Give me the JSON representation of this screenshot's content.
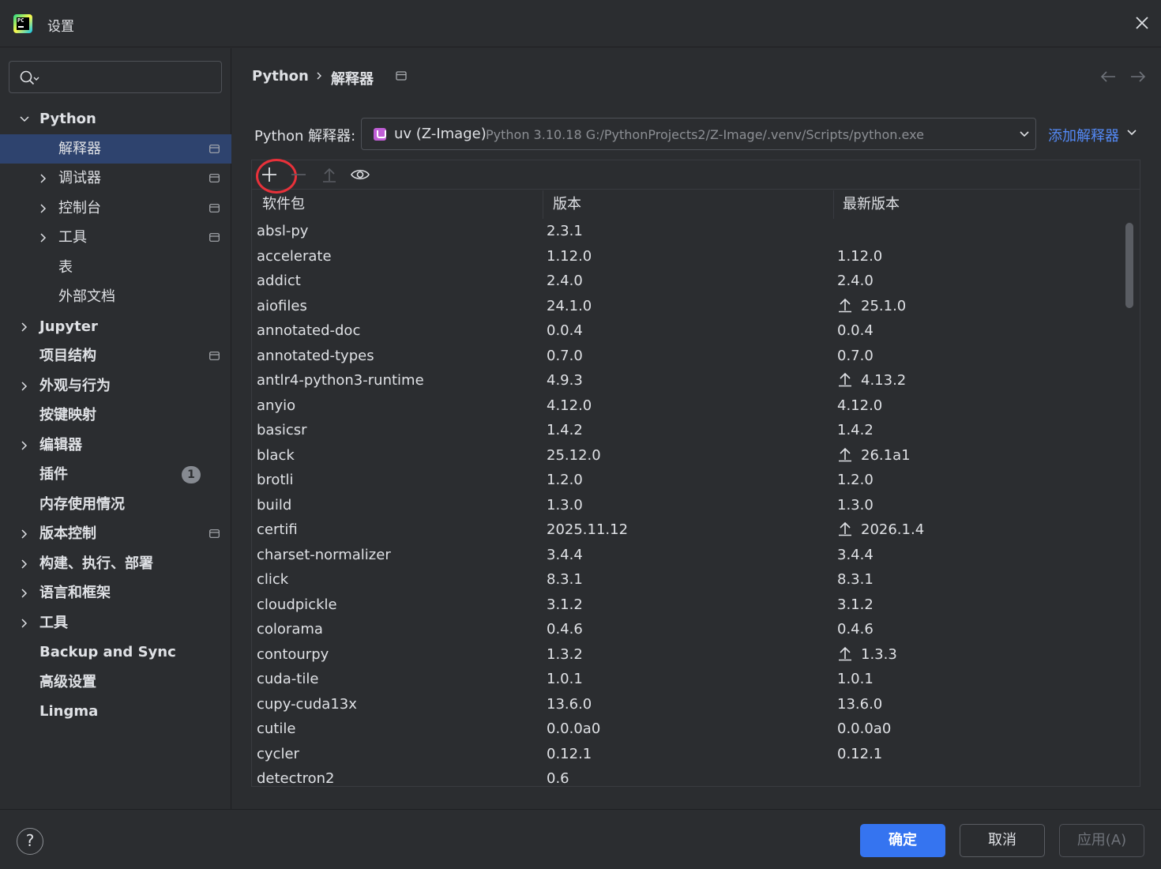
{
  "window": {
    "title": "设置"
  },
  "sidebar": {
    "items": [
      {
        "label": "Python",
        "level": 0,
        "expanded": true,
        "bold": true,
        "has_page_icon": false
      },
      {
        "label": "解释器",
        "level": 1,
        "selected": true,
        "has_page_icon": true
      },
      {
        "label": "调试器",
        "level": 1,
        "collapsed": true,
        "has_page_icon": true
      },
      {
        "label": "控制台",
        "level": 1,
        "collapsed": true,
        "has_page_icon": true
      },
      {
        "label": "工具",
        "level": 1,
        "collapsed": true,
        "has_page_icon": true
      },
      {
        "label": "表",
        "level": 1
      },
      {
        "label": "外部文档",
        "level": 1
      },
      {
        "label": "Jupyter",
        "level": 0,
        "collapsed": true,
        "bold": true
      },
      {
        "label": "项目结构",
        "level": 0,
        "bold": true,
        "has_page_icon": true
      },
      {
        "label": "外观与行为",
        "level": 0,
        "collapsed": true,
        "bold": true
      },
      {
        "label": "按键映射",
        "level": 0,
        "bold": true
      },
      {
        "label": "编辑器",
        "level": 0,
        "collapsed": true,
        "bold": true
      },
      {
        "label": "插件",
        "level": 0,
        "bold": true,
        "badge": "1"
      },
      {
        "label": "内存使用情况",
        "level": 0,
        "bold": true
      },
      {
        "label": "版本控制",
        "level": 0,
        "collapsed": true,
        "bold": true,
        "has_page_icon": true
      },
      {
        "label": "构建、执行、部署",
        "level": 0,
        "collapsed": true,
        "bold": true
      },
      {
        "label": "语言和框架",
        "level": 0,
        "collapsed": true,
        "bold": true
      },
      {
        "label": "工具",
        "level": 0,
        "collapsed": true,
        "bold": true
      },
      {
        "label": "Backup and Sync",
        "level": 0,
        "bold": true
      },
      {
        "label": "高级设置",
        "level": 0,
        "bold": true
      },
      {
        "label": "Lingma",
        "level": 0,
        "bold": true
      }
    ]
  },
  "breadcrumb": {
    "root": "Python",
    "current": "解释器"
  },
  "interpreter": {
    "label": "Python 解释器:",
    "name": "uv (Z-Image)",
    "detail": "Python 3.10.18 G:/PythonProjects2/Z-Image/.venv/Scripts/python.exe",
    "add_label": "添加解释器"
  },
  "packages": {
    "columns": [
      "软件包",
      "版本",
      "最新版本"
    ],
    "rows": [
      {
        "name": "absl-py",
        "version": "2.3.1",
        "latest": "",
        "upgrade": false
      },
      {
        "name": "accelerate",
        "version": "1.12.0",
        "latest": "1.12.0",
        "upgrade": false
      },
      {
        "name": "addict",
        "version": "2.4.0",
        "latest": "2.4.0",
        "upgrade": false
      },
      {
        "name": "aiofiles",
        "version": "24.1.0",
        "latest": "25.1.0",
        "upgrade": true
      },
      {
        "name": "annotated-doc",
        "version": "0.0.4",
        "latest": "0.0.4",
        "upgrade": false
      },
      {
        "name": "annotated-types",
        "version": "0.7.0",
        "latest": "0.7.0",
        "upgrade": false
      },
      {
        "name": "antlr4-python3-runtime",
        "version": "4.9.3",
        "latest": "4.13.2",
        "upgrade": true
      },
      {
        "name": "anyio",
        "version": "4.12.0",
        "latest": "4.12.0",
        "upgrade": false
      },
      {
        "name": "basicsr",
        "version": "1.4.2",
        "latest": "1.4.2",
        "upgrade": false
      },
      {
        "name": "black",
        "version": "25.12.0",
        "latest": "26.1a1",
        "upgrade": true
      },
      {
        "name": "brotli",
        "version": "1.2.0",
        "latest": "1.2.0",
        "upgrade": false
      },
      {
        "name": "build",
        "version": "1.3.0",
        "latest": "1.3.0",
        "upgrade": false
      },
      {
        "name": "certifi",
        "version": "2025.11.12",
        "latest": "2026.1.4",
        "upgrade": true
      },
      {
        "name": "charset-normalizer",
        "version": "3.4.4",
        "latest": "3.4.4",
        "upgrade": false
      },
      {
        "name": "click",
        "version": "8.3.1",
        "latest": "8.3.1",
        "upgrade": false
      },
      {
        "name": "cloudpickle",
        "version": "3.1.2",
        "latest": "3.1.2",
        "upgrade": false
      },
      {
        "name": "colorama",
        "version": "0.4.6",
        "latest": "0.4.6",
        "upgrade": false
      },
      {
        "name": "contourpy",
        "version": "1.3.2",
        "latest": "1.3.3",
        "upgrade": true
      },
      {
        "name": "cuda-tile",
        "version": "1.0.1",
        "latest": "1.0.1",
        "upgrade": false
      },
      {
        "name": "cupy-cuda13x",
        "version": "13.6.0",
        "latest": "13.6.0",
        "upgrade": false
      },
      {
        "name": "cutile",
        "version": "0.0.0a0",
        "latest": "0.0.0a0",
        "upgrade": false
      },
      {
        "name": "cycler",
        "version": "0.12.1",
        "latest": "0.12.1",
        "upgrade": false
      },
      {
        "name": "detectron2",
        "version": "0.6",
        "latest": "",
        "upgrade": false
      }
    ]
  },
  "footer": {
    "help": "?",
    "ok": "确定",
    "cancel": "取消",
    "apply": "应用(A)"
  },
  "colors": {
    "accent": "#3574f0",
    "selection": "#2e436e",
    "link": "#548af7",
    "highlight_ring": "#e8313a"
  }
}
